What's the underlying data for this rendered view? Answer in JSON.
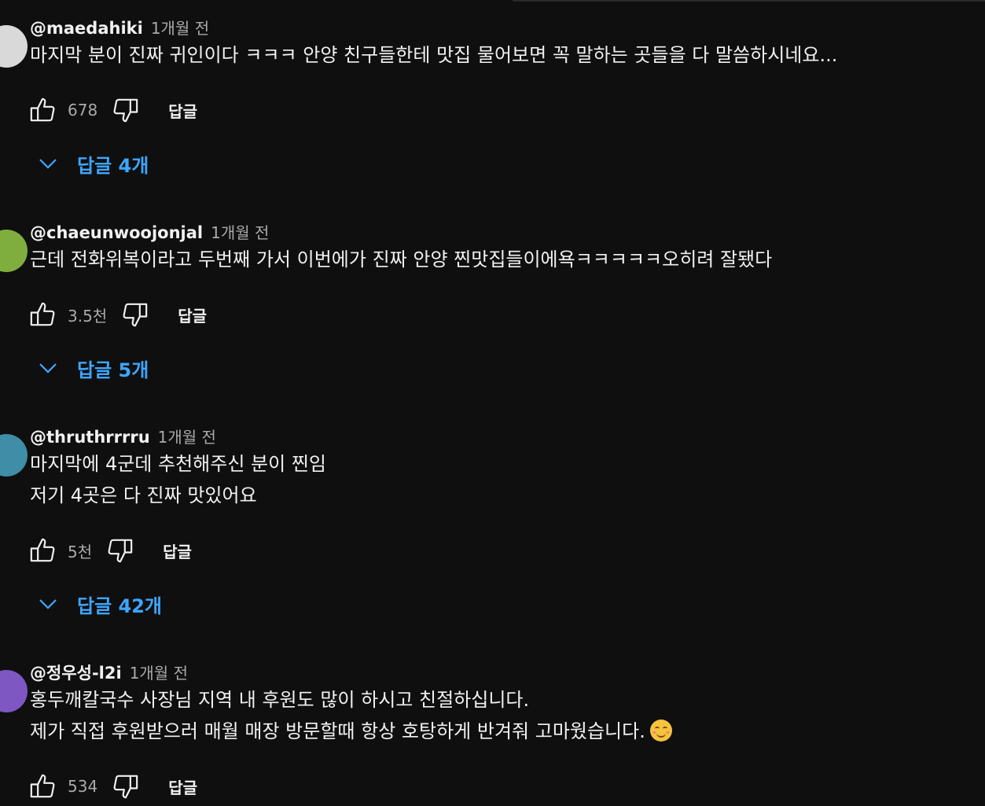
{
  "colors": {
    "background": "#0f0f0f",
    "text_primary": "#f1f1f1",
    "text_secondary": "#aaaaaa",
    "link_blue": "#3ea6ff"
  },
  "comments": [
    {
      "author": "@maedahiki",
      "time": "1개월 전",
      "avatar_color": "#d9d9d9",
      "text_lines": [
        "마지막 분이 진짜 귀인이다 ㅋㅋㅋ 안양 친구들한테 맛집 물어보면 꼭 말하는 곳들을 다 말씀하시네요..."
      ],
      "likes": "678",
      "reply_label": "답글",
      "replies_label": "답글 4개"
    },
    {
      "author": "@chaeunwoojonjal",
      "time": "1개월 전",
      "avatar_color": "#7fae3e",
      "text_lines": [
        "근데 전화위복이라고 두번째 가서 이번에가 진짜 안양 찐맛집들이에욕ㅋㅋㅋㅋㅋ오히려 잘됐다"
      ],
      "likes": "3.5천",
      "reply_label": "답글",
      "replies_label": "답글 5개"
    },
    {
      "author": "@thruthrrrru",
      "time": "1개월 전",
      "avatar_color": "#3f8da6",
      "text_lines": [
        "마지막에 4군데 추천해주신 분이 찐임",
        "저기 4곳은 다 진짜 맛있어요"
      ],
      "likes": "5천",
      "reply_label": "답글",
      "replies_label": "답글 42개"
    },
    {
      "author": "@정우성-l2i",
      "time": "1개월 전",
      "avatar_color": "#7e57c2",
      "text_lines": [
        "홍두깨칼국수 사장님 지역 내 후원도 많이 하시고 친절하십니다.",
        "제가 직접 후원받으러 매월 매장 방문할때 항상 호탕하게 반겨줘 고마웠습니다."
      ],
      "emoji": "smiling-face-emoji",
      "likes": "534",
      "reply_label": "답글"
    }
  ]
}
